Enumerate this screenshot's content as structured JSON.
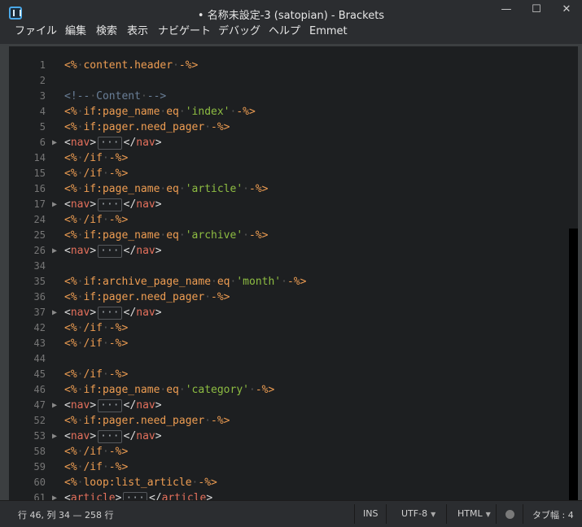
{
  "window": {
    "title": "• 名称未設定-3 (satopian) - Brackets",
    "minimize_glyph": "—",
    "maximize_glyph": "☐",
    "close_glyph": "✕"
  },
  "menu": [
    "ファイル",
    "編集",
    "検索",
    "表示",
    "ナビゲート",
    "デバッグ",
    "ヘルプ",
    "Emmet"
  ],
  "editor": {
    "lines": [
      {
        "n": "1",
        "fold": false,
        "segs": [
          [
            "t-tag",
            "<%"
          ],
          [
            "t-dot",
            "·"
          ],
          [
            "t-kw",
            "content.header"
          ],
          [
            "t-dot",
            "·"
          ],
          [
            "t-tag",
            "-%>"
          ]
        ]
      },
      {
        "n": "2",
        "fold": false,
        "segs": []
      },
      {
        "n": "3",
        "fold": false,
        "segs": [
          [
            "t-cmt",
            "<!--"
          ],
          [
            "t-dot",
            "·"
          ],
          [
            "t-cmt",
            "Content"
          ],
          [
            "t-dot",
            "·"
          ],
          [
            "t-cmt",
            "-->"
          ]
        ]
      },
      {
        "n": "4",
        "fold": false,
        "segs": [
          [
            "t-tag",
            "<%"
          ],
          [
            "t-dot",
            "·"
          ],
          [
            "t-kw",
            "if:page_name"
          ],
          [
            "t-dot",
            "·"
          ],
          [
            "t-kw",
            "eq"
          ],
          [
            "t-dot",
            "·"
          ],
          [
            "t-str",
            "'index'"
          ],
          [
            "t-dot",
            "·"
          ],
          [
            "t-tag",
            "-%>"
          ]
        ]
      },
      {
        "n": "5",
        "fold": false,
        "segs": [
          [
            "t-tag",
            "<%"
          ],
          [
            "t-dot",
            "·"
          ],
          [
            "t-kw",
            "if:pager.need_pager"
          ],
          [
            "t-dot",
            "·"
          ],
          [
            "t-tag",
            "-%>"
          ]
        ]
      },
      {
        "n": "6",
        "fold": true,
        "segs": [
          [
            "",
            "<"
          ],
          [
            "t-html",
            "nav"
          ],
          [
            "",
            ">"
          ],
          [
            "t-fold",
            "···"
          ],
          [
            "",
            "</"
          ],
          [
            "t-html",
            "nav"
          ],
          [
            "",
            ">"
          ]
        ]
      },
      {
        "n": "14",
        "fold": false,
        "segs": [
          [
            "t-tag",
            "<%"
          ],
          [
            "t-dot",
            "·"
          ],
          [
            "t-kw",
            "/if"
          ],
          [
            "t-dot",
            "·"
          ],
          [
            "t-tag",
            "-%>"
          ]
        ]
      },
      {
        "n": "15",
        "fold": false,
        "segs": [
          [
            "t-tag",
            "<%"
          ],
          [
            "t-dot",
            "·"
          ],
          [
            "t-kw",
            "/if"
          ],
          [
            "t-dot",
            "·"
          ],
          [
            "t-tag",
            "-%>"
          ]
        ]
      },
      {
        "n": "16",
        "fold": false,
        "segs": [
          [
            "t-tag",
            "<%"
          ],
          [
            "t-dot",
            "·"
          ],
          [
            "t-kw",
            "if:page_name"
          ],
          [
            "t-dot",
            "·"
          ],
          [
            "t-kw",
            "eq"
          ],
          [
            "t-dot",
            "·"
          ],
          [
            "t-str",
            "'article'"
          ],
          [
            "t-dot",
            "·"
          ],
          [
            "t-tag",
            "-%>"
          ]
        ]
      },
      {
        "n": "17",
        "fold": true,
        "segs": [
          [
            "",
            "<"
          ],
          [
            "t-html",
            "nav"
          ],
          [
            "",
            ">"
          ],
          [
            "t-fold",
            "···"
          ],
          [
            "",
            "</"
          ],
          [
            "t-html",
            "nav"
          ],
          [
            "",
            ">"
          ]
        ]
      },
      {
        "n": "24",
        "fold": false,
        "segs": [
          [
            "t-tag",
            "<%"
          ],
          [
            "t-dot",
            "·"
          ],
          [
            "t-kw",
            "/if"
          ],
          [
            "t-dot",
            "·"
          ],
          [
            "t-tag",
            "-%>"
          ]
        ]
      },
      {
        "n": "25",
        "fold": false,
        "segs": [
          [
            "t-tag",
            "<%"
          ],
          [
            "t-dot",
            "·"
          ],
          [
            "t-kw",
            "if:page_name"
          ],
          [
            "t-dot",
            "·"
          ],
          [
            "t-kw",
            "eq"
          ],
          [
            "t-dot",
            "·"
          ],
          [
            "t-str",
            "'archive'"
          ],
          [
            "t-dot",
            "·"
          ],
          [
            "t-tag",
            "-%>"
          ]
        ]
      },
      {
        "n": "26",
        "fold": true,
        "segs": [
          [
            "",
            "<"
          ],
          [
            "t-html",
            "nav"
          ],
          [
            "",
            ">"
          ],
          [
            "t-fold",
            "···"
          ],
          [
            "",
            "</"
          ],
          [
            "t-html",
            "nav"
          ],
          [
            "",
            ">"
          ]
        ]
      },
      {
        "n": "34",
        "fold": false,
        "segs": []
      },
      {
        "n": "35",
        "fold": false,
        "segs": [
          [
            "t-tag",
            "<%"
          ],
          [
            "t-dot",
            "·"
          ],
          [
            "t-kw",
            "if:archive_page_name"
          ],
          [
            "t-dot",
            "·"
          ],
          [
            "t-kw",
            "eq"
          ],
          [
            "t-dot",
            "·"
          ],
          [
            "t-str",
            "'month'"
          ],
          [
            "t-dot",
            "·"
          ],
          [
            "t-tag",
            "-%>"
          ]
        ]
      },
      {
        "n": "36",
        "fold": false,
        "segs": [
          [
            "t-tag",
            "<%"
          ],
          [
            "t-dot",
            "·"
          ],
          [
            "t-kw",
            "if:pager.need_pager"
          ],
          [
            "t-dot",
            "·"
          ],
          [
            "t-tag",
            "-%>"
          ]
        ]
      },
      {
        "n": "37",
        "fold": true,
        "segs": [
          [
            "",
            "<"
          ],
          [
            "t-html",
            "nav"
          ],
          [
            "",
            ">"
          ],
          [
            "t-fold",
            "···"
          ],
          [
            "",
            "</"
          ],
          [
            "t-html",
            "nav"
          ],
          [
            "",
            ">"
          ]
        ]
      },
      {
        "n": "42",
        "fold": false,
        "segs": [
          [
            "t-tag",
            "<%"
          ],
          [
            "t-dot",
            "·"
          ],
          [
            "t-kw",
            "/if"
          ],
          [
            "t-dot",
            "·"
          ],
          [
            "t-tag",
            "-%>"
          ]
        ]
      },
      {
        "n": "43",
        "fold": false,
        "segs": [
          [
            "t-tag",
            "<%"
          ],
          [
            "t-dot",
            "·"
          ],
          [
            "t-kw",
            "/if"
          ],
          [
            "t-dot",
            "·"
          ],
          [
            "t-tag",
            "-%>"
          ]
        ]
      },
      {
        "n": "44",
        "fold": false,
        "segs": []
      },
      {
        "n": "45",
        "fold": false,
        "segs": [
          [
            "t-tag",
            "<%"
          ],
          [
            "t-dot",
            "·"
          ],
          [
            "t-kw",
            "/if"
          ],
          [
            "t-dot",
            "·"
          ],
          [
            "t-tag",
            "-%>"
          ]
        ]
      },
      {
        "n": "46",
        "fold": false,
        "segs": [
          [
            "t-tag",
            "<%"
          ],
          [
            "t-dot",
            "·"
          ],
          [
            "t-kw",
            "if:page_name"
          ],
          [
            "t-dot",
            "·"
          ],
          [
            "t-kw",
            "eq"
          ],
          [
            "t-dot",
            "·"
          ],
          [
            "t-str",
            "'category'"
          ],
          [
            "t-dot",
            "·"
          ],
          [
            "t-tag",
            "-%>"
          ]
        ]
      },
      {
        "n": "47",
        "fold": true,
        "segs": [
          [
            "",
            "<"
          ],
          [
            "t-html",
            "nav"
          ],
          [
            "",
            ">"
          ],
          [
            "t-fold",
            "···"
          ],
          [
            "",
            "</"
          ],
          [
            "t-html",
            "nav"
          ],
          [
            "",
            ">"
          ]
        ]
      },
      {
        "n": "52",
        "fold": false,
        "segs": [
          [
            "t-tag",
            "<%"
          ],
          [
            "t-dot",
            "·"
          ],
          [
            "t-kw",
            "if:pager.need_pager"
          ],
          [
            "t-dot",
            "·"
          ],
          [
            "t-tag",
            "-%>"
          ]
        ]
      },
      {
        "n": "53",
        "fold": true,
        "segs": [
          [
            "",
            "<"
          ],
          [
            "t-html",
            "nav"
          ],
          [
            "",
            ">"
          ],
          [
            "t-fold",
            "···"
          ],
          [
            "",
            "</"
          ],
          [
            "t-html",
            "nav"
          ],
          [
            "",
            ">"
          ]
        ]
      },
      {
        "n": "58",
        "fold": false,
        "segs": [
          [
            "t-tag",
            "<%"
          ],
          [
            "t-dot",
            "·"
          ],
          [
            "t-kw",
            "/if"
          ],
          [
            "t-dot",
            "·"
          ],
          [
            "t-tag",
            "-%>"
          ]
        ]
      },
      {
        "n": "59",
        "fold": false,
        "segs": [
          [
            "t-tag",
            "<%"
          ],
          [
            "t-dot",
            "·"
          ],
          [
            "t-kw",
            "/if"
          ],
          [
            "t-dot",
            "·"
          ],
          [
            "t-tag",
            "-%>"
          ]
        ]
      },
      {
        "n": "60",
        "fold": false,
        "segs": [
          [
            "t-tag",
            "<%"
          ],
          [
            "t-dot",
            "·"
          ],
          [
            "t-kw",
            "loop:list_article"
          ],
          [
            "t-dot",
            "·"
          ],
          [
            "t-tag",
            "-%>"
          ]
        ]
      },
      {
        "n": "61",
        "fold": true,
        "segs": [
          [
            "",
            "<"
          ],
          [
            "t-html",
            "article"
          ],
          [
            "",
            ">"
          ],
          [
            "t-fold",
            "···"
          ],
          [
            "",
            "</"
          ],
          [
            "t-html",
            "article"
          ],
          [
            "",
            ">"
          ]
        ]
      }
    ]
  },
  "status": {
    "cursor": "行 46, 列 34 — 258 行",
    "mode": "INS",
    "encoding": "UTF-8",
    "language": "HTML",
    "tab_size": "タブ幅 : 4",
    "dropdown_glyph": "▼"
  }
}
